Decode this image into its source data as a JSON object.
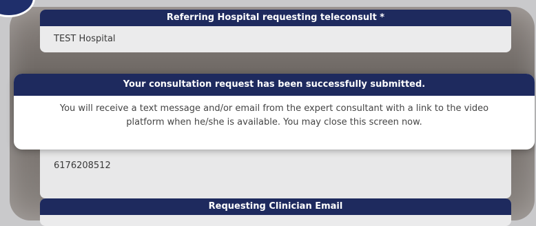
{
  "form": {
    "referring_hospital": {
      "label": "Referring Hospital requesting teleconsult *",
      "value": "TEST Hospital"
    },
    "phone": {
      "value": "6176208512"
    },
    "clinician_email": {
      "label": "Requesting Clinician Email"
    }
  },
  "modal": {
    "title": "Your consultation request has been successfully submitted.",
    "message": "You will receive a text message and/or email from the expert consultant with a link to the video platform when he/she is available. You may close this screen now."
  },
  "colors": {
    "header_navy": "#1e2a5e",
    "background": "#c9c9cb"
  }
}
